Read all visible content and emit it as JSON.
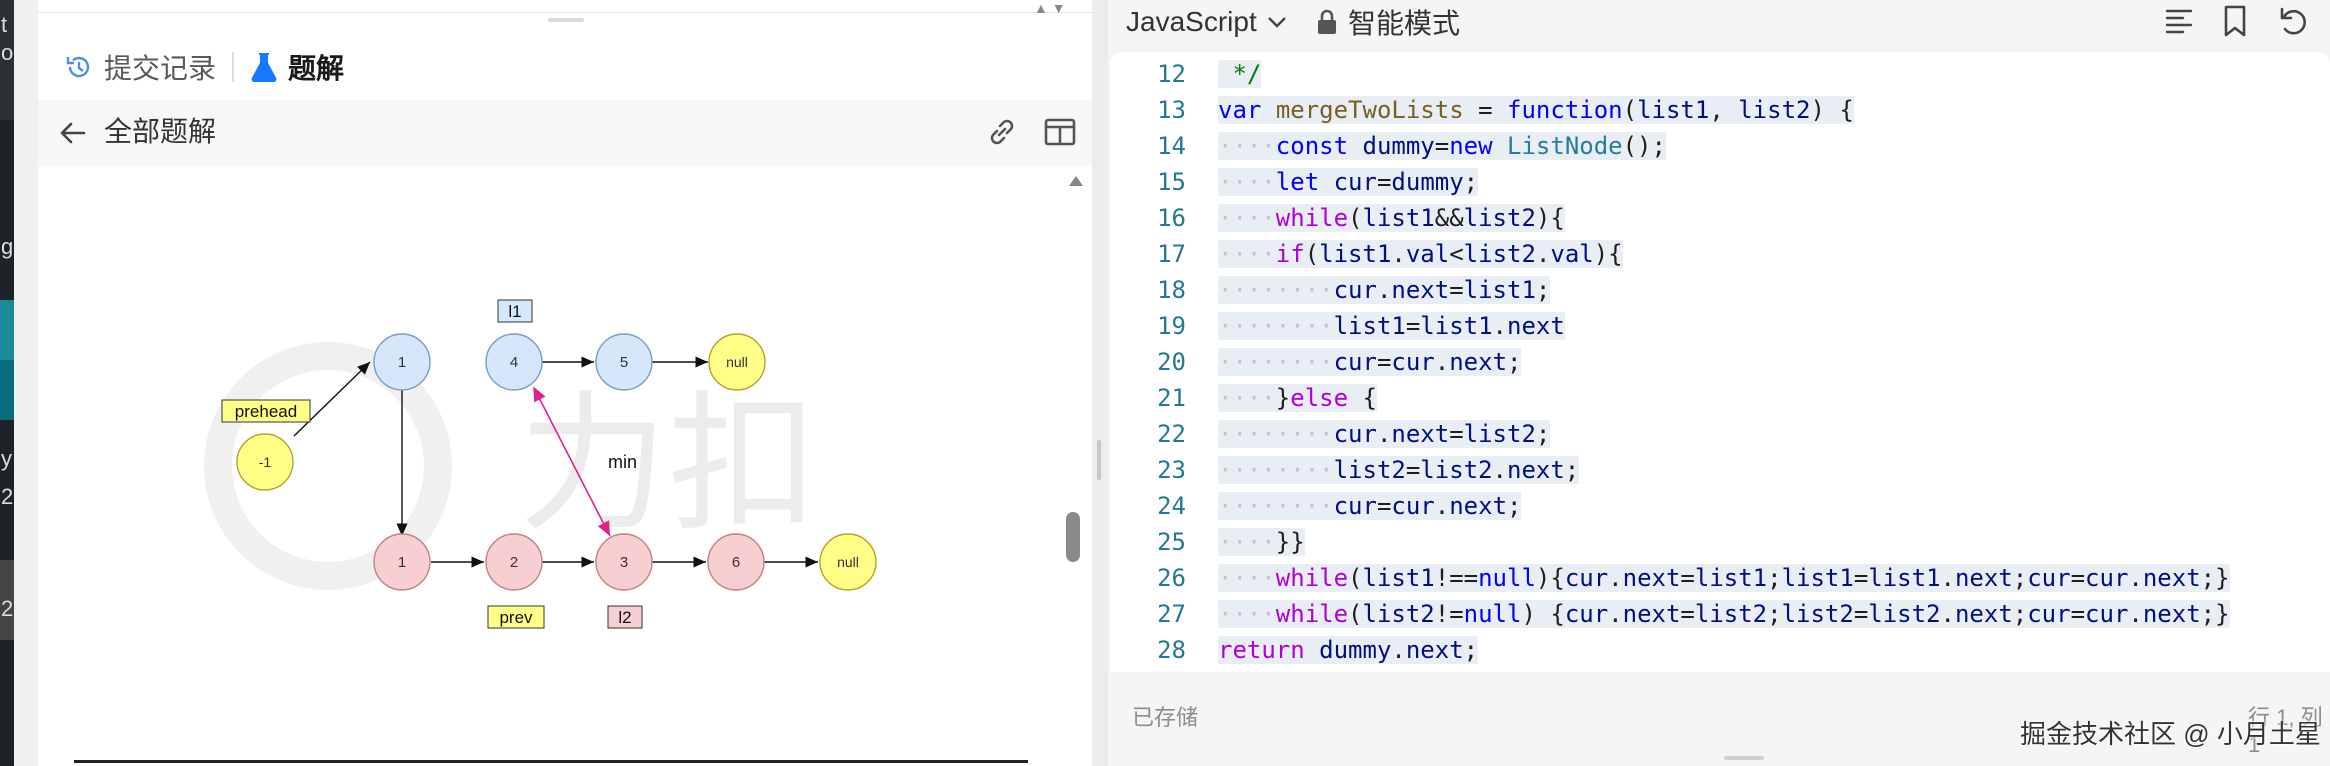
{
  "edge_strip": {
    "glyphs": [
      "t",
      "o",
      "g",
      "y",
      "2",
      "2"
    ]
  },
  "left_tabs": {
    "submissions_label": "提交记录",
    "solutions_label": "题解"
  },
  "solution_header": {
    "back_title": "全部题解"
  },
  "diagram": {
    "nodes_top": [
      "1",
      "4",
      "5",
      "null"
    ],
    "nodes_bottom": [
      "1",
      "2",
      "3",
      "6",
      "null"
    ],
    "prehead_node": "-1",
    "labels": {
      "prehead": "prehead",
      "l1": "l1",
      "l2": "l2",
      "prev": "prev",
      "min": "min"
    },
    "watermark_text": "力扣",
    "colors": {
      "blue_node": "#d6e6fb",
      "red_node": "#f8cfd0",
      "yellow_node": "#ffff88",
      "pink_arrow": "#e0208f"
    }
  },
  "editor": {
    "language": "JavaScript",
    "mode": "智能模式",
    "line_numbers": [
      "12",
      "13",
      "14",
      "15",
      "16",
      "17",
      "18",
      "19",
      "20",
      "21",
      "22",
      "23",
      "24",
      "25",
      "26",
      "27",
      "28"
    ],
    "status": "已存储",
    "cursor": "行 1, 列 1"
  },
  "watermark": "掘金技术社区 @ 小月土星"
}
